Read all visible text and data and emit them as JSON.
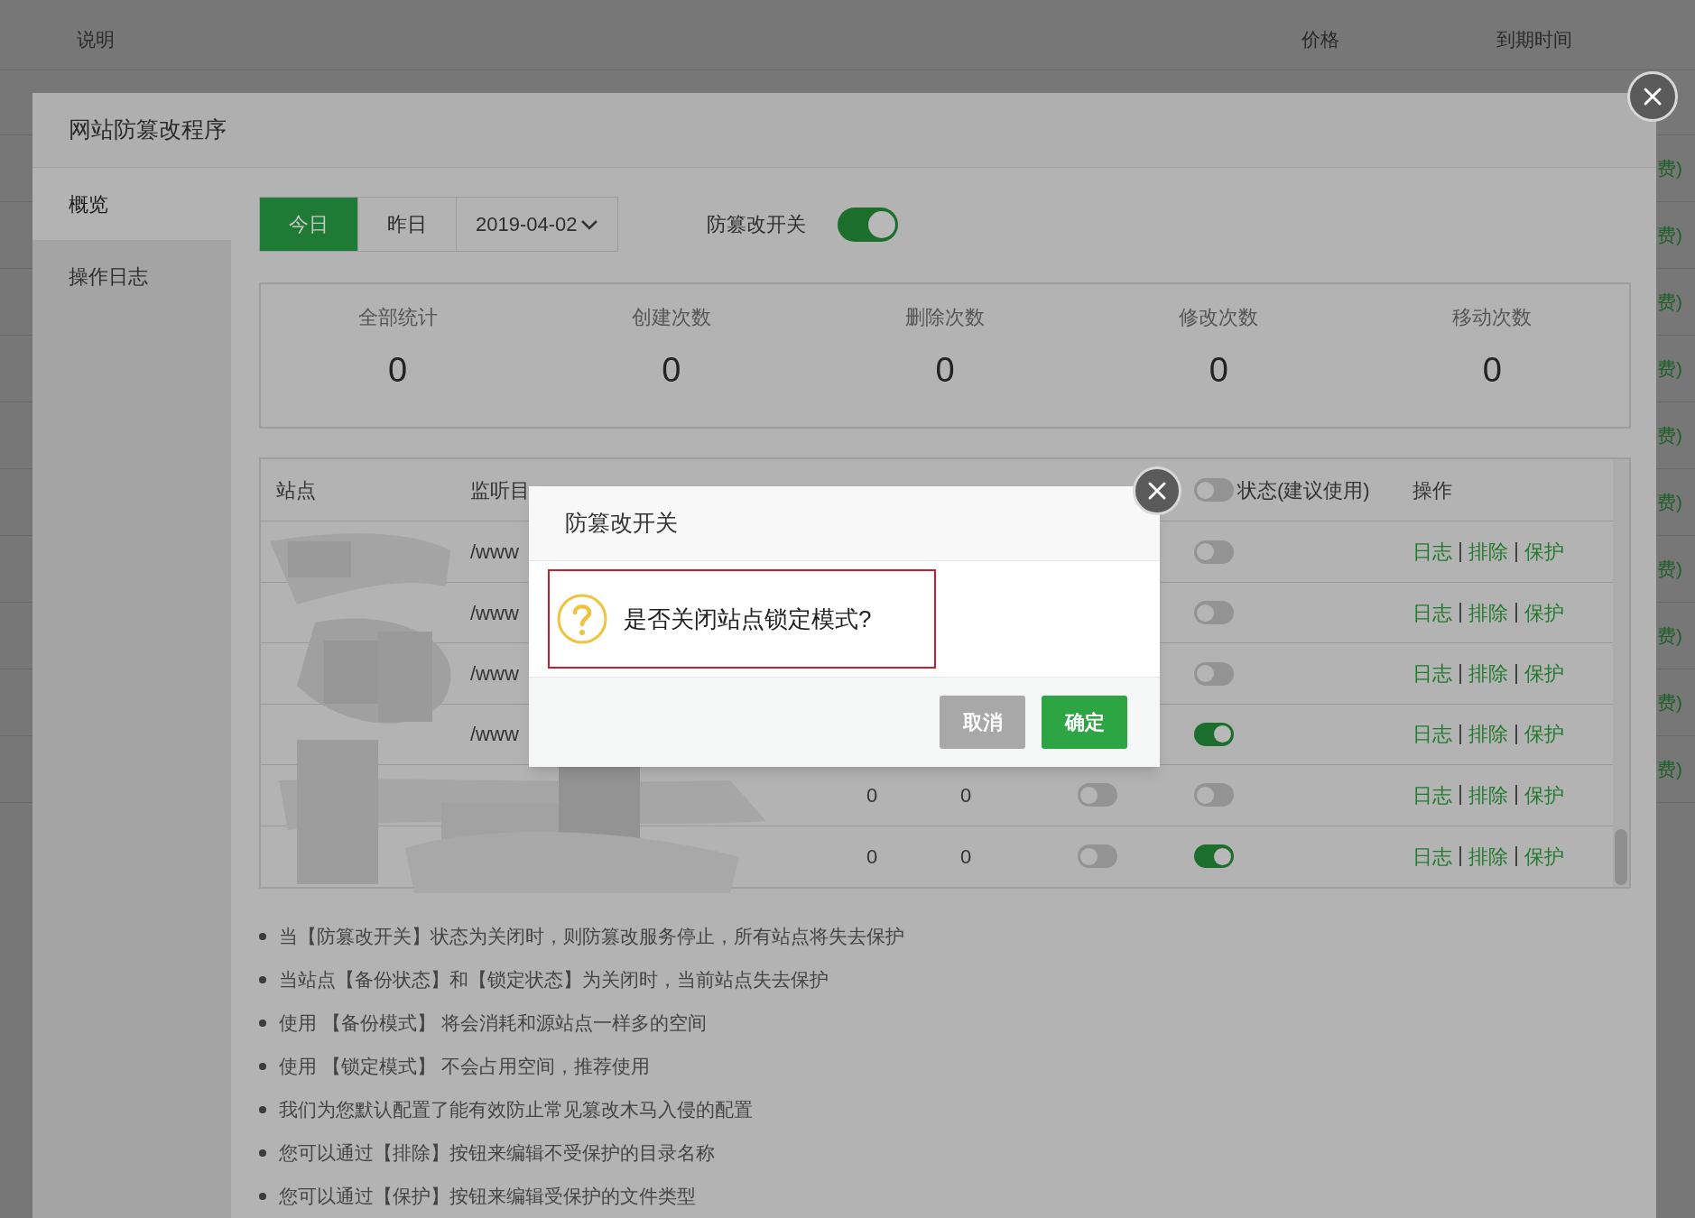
{
  "background_page": {
    "columns": [
      "说明",
      "价格",
      "到期时间"
    ],
    "rows": [
      "费)",
      "费)",
      "费)",
      "费)",
      "费)",
      "费)",
      "费)",
      "费)",
      "费)",
      "费)"
    ]
  },
  "window": {
    "title": "网站防篡改程序"
  },
  "sidebar": {
    "items": [
      {
        "label": "概览",
        "selected": true
      },
      {
        "label": "操作日志",
        "selected": false
      }
    ]
  },
  "date_tabs": [
    {
      "label": "今日",
      "selected": true
    },
    {
      "label": "昨日",
      "selected": false
    }
  ],
  "date_picker": {
    "value": "2019-04-02"
  },
  "master_switch": {
    "label": "防篡改开关",
    "on": true
  },
  "stats": [
    {
      "label": "全部统计",
      "value": "0"
    },
    {
      "label": "创建次数",
      "value": "0"
    },
    {
      "label": "删除次数",
      "value": "0"
    },
    {
      "label": "修改次数",
      "value": "0"
    },
    {
      "label": "移动次数",
      "value": "0"
    }
  ],
  "table": {
    "columns": [
      {
        "label": "站点"
      },
      {
        "label": "监听目"
      },
      {
        "label": "状态(建议使用)",
        "kind": "toggle_header",
        "on": false
      },
      {
        "label": "操作"
      }
    ],
    "rows": [
      {
        "directory": "/www",
        "lock": false,
        "actions": [
          "日志",
          "排除",
          "保护"
        ]
      },
      {
        "directory": "/www",
        "lock": false,
        "actions": [
          "日志",
          "排除",
          "保护"
        ]
      },
      {
        "directory": "/www",
        "lock": false,
        "actions": [
          "日志",
          "排除",
          "保护"
        ]
      },
      {
        "directory": "/www",
        "lock": true,
        "actions": [
          "日志",
          "排除",
          "保护"
        ]
      },
      {
        "total": "0",
        "today": "0",
        "backup": false,
        "lock": false,
        "actions": [
          "日志",
          "排除",
          "保护"
        ]
      },
      {
        "total": "0",
        "today": "0",
        "backup": false,
        "lock": true,
        "actions": [
          "日志",
          "排除",
          "保护"
        ]
      }
    ]
  },
  "notes": [
    "当【防篡改开关】状态为关闭时，则防篡改服务停止，所有站点将失去保护",
    "当站点【备份状态】和【锁定状态】为关闭时，当前站点失去保护",
    "使用 【备份模式】 将会消耗和源站点一样多的空间",
    "使用 【锁定模式】 不会占用空间，推荐使用",
    "我们为您默认配置了能有效防止常见篡改木马入侵的配置",
    "您可以通过【排除】按钮来编辑不受保护的目录名称",
    "您可以通过【保护】按钮来编辑受保护的文件类型"
  ],
  "confirm_dialog": {
    "title": "防篡改开关",
    "message": "是否关闭站点锁定模式?",
    "buttons": [
      {
        "label": "取消",
        "kind": "cancel"
      },
      {
        "label": "确定",
        "kind": "confirm"
      }
    ]
  }
}
